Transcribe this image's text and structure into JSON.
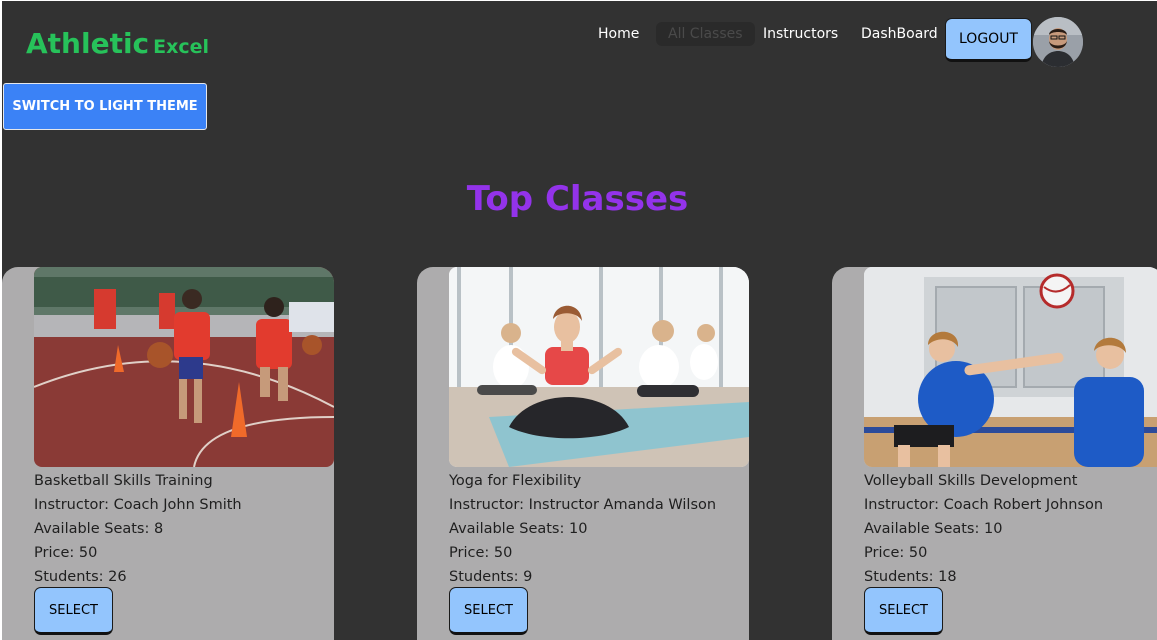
{
  "brand": {
    "name_main": "Athletic",
    "name_sub": "Excel",
    "color": "#27c25a"
  },
  "nav": {
    "links": [
      {
        "label": "Home"
      },
      {
        "label": "All Classes"
      },
      {
        "label": "Instructors"
      },
      {
        "label": "DashBoard"
      }
    ],
    "logout_label": "LOGOUT",
    "avatar_icon": "user-avatar"
  },
  "theme_toggle": {
    "label": "SWITCH TO LIGHT THEME",
    "color": "#3b82f6"
  },
  "section": {
    "title": "Top Classes",
    "title_color": "#9333ea"
  },
  "classes": [
    {
      "name": "Basketball Skills Training",
      "instructor_line": "Instructor: Coach John Smith",
      "seats_line": "Available Seats: 8",
      "price_line": "Price: 50",
      "students_line": "Students: 26",
      "select_label": "SELECT",
      "image_icon": "basketball-photo"
    },
    {
      "name": "Yoga for Flexibility",
      "instructor_line": "Instructor: Instructor Amanda Wilson",
      "seats_line": "Available Seats: 10",
      "price_line": "Price: 50",
      "students_line": "Students: 9",
      "select_label": "SELECT",
      "image_icon": "yoga-photo"
    },
    {
      "name": "Volleyball Skills Development",
      "instructor_line": "Instructor: Coach Robert Johnson",
      "seats_line": "Available Seats: 10",
      "price_line": "Price: 50",
      "students_line": "Students: 18",
      "select_label": "SELECT",
      "image_icon": "volleyball-photo"
    }
  ],
  "colors": {
    "background": "#323232",
    "card": "#adacad",
    "button": "#93c5fd"
  }
}
